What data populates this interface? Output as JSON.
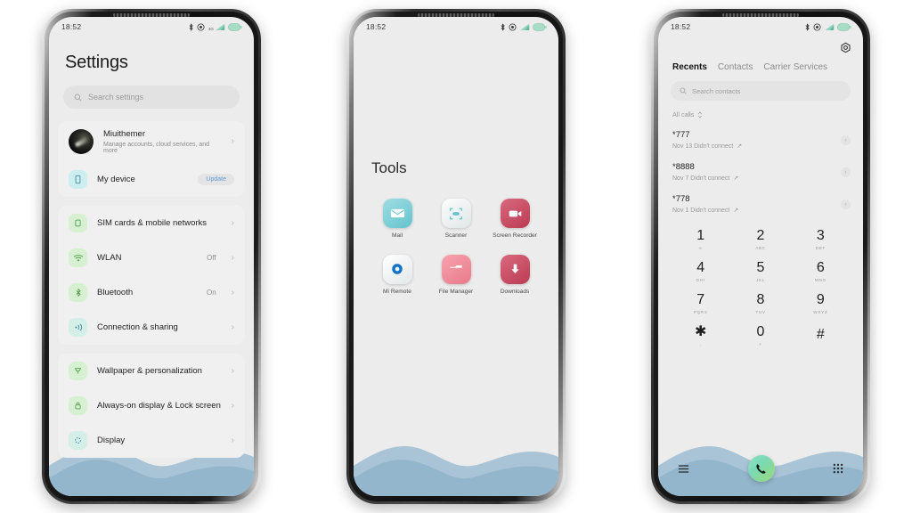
{
  "phones": {
    "settings": {
      "status": {
        "time": "18:52",
        "network": "4G",
        "icons": [
          "bluetooth-icon",
          "mute-icon",
          "signal-icon",
          "battery-icon"
        ]
      },
      "title": "Settings",
      "search_placeholder": "Search settings",
      "account": {
        "name": "Miuithemer",
        "subtitle": "Manage accounts, cloud services, and more",
        "chevron": "›"
      },
      "device": {
        "label": "My device",
        "badge": "Update",
        "badge_color": "#5b9bd5"
      },
      "items": [
        {
          "label": "SIM cards & mobile networks",
          "value": "",
          "icon": "sim-icon",
          "color": "#d8f0d2"
        },
        {
          "label": "WLAN",
          "value": "Off",
          "icon": "wifi-icon",
          "color": "#d8f0d2"
        },
        {
          "label": "Bluetooth",
          "value": "On",
          "icon": "bluetooth-icon",
          "color": "#d8f0d2"
        },
        {
          "label": "Connection & sharing",
          "value": "",
          "icon": "share-icon",
          "color": "#d4eee8"
        }
      ],
      "items2": [
        {
          "label": "Wallpaper & personalization",
          "value": "",
          "icon": "wallpaper-icon",
          "color": "#d8f0d2"
        },
        {
          "label": "Always-on display & Lock screen",
          "value": "",
          "icon": "lock-icon",
          "color": "#d8f0d2"
        },
        {
          "label": "Display",
          "value": "",
          "icon": "display-icon",
          "color": "#d4eee8"
        }
      ],
      "chevron": "›"
    },
    "tools": {
      "status": {
        "time": "18:52",
        "network": "",
        "icons": [
          "bluetooth-icon",
          "mute-icon",
          "signal-icon",
          "battery-icon"
        ]
      },
      "title": "Tools",
      "apps": [
        {
          "name": "Mail",
          "icon": "mail-icon",
          "color": "#7fd0d8"
        },
        {
          "name": "Scanner",
          "icon": "scanner-icon",
          "color": "#eef1f1"
        },
        {
          "name": "Screen Recorder",
          "icon": "recorder-icon",
          "color": "#c94b60"
        },
        {
          "name": "Mi Remote",
          "icon": "remote-icon",
          "color": "#f2f4f5"
        },
        {
          "name": "File Manager",
          "icon": "folder-icon",
          "color": "#ef8a97"
        },
        {
          "name": "Downloads",
          "icon": "download-icon",
          "color": "#c94b60"
        }
      ]
    },
    "dialer": {
      "status": {
        "time": "18:52",
        "network": "",
        "icons": [
          "bluetooth-icon",
          "mute-icon",
          "signal-icon",
          "battery-icon"
        ]
      },
      "gear": "settings-gear-icon",
      "tabs": [
        {
          "label": "Recents",
          "active": true
        },
        {
          "label": "Contacts",
          "active": false
        },
        {
          "label": "Carrier Services",
          "active": false
        }
      ],
      "search_placeholder": "Search contacts",
      "filter": "All calls",
      "calls": [
        {
          "number": "*777",
          "meta": "Nov 13 Didn't connect",
          "arrow": "↗",
          "chevron": "›"
        },
        {
          "number": "*8888",
          "meta": "Nov 7 Didn't connect",
          "arrow": "↗",
          "chevron": "›"
        },
        {
          "number": "*778",
          "meta": "Nov 1 Didn't connect",
          "arrow": "↗",
          "chevron": "›"
        }
      ],
      "keypad": [
        {
          "digit": "1",
          "letters": "∞"
        },
        {
          "digit": "2",
          "letters": "ABC"
        },
        {
          "digit": "3",
          "letters": "DEF"
        },
        {
          "digit": "4",
          "letters": "GHI"
        },
        {
          "digit": "5",
          "letters": "JKL"
        },
        {
          "digit": "6",
          "letters": "MNO"
        },
        {
          "digit": "7",
          "letters": "PQRS"
        },
        {
          "digit": "8",
          "letters": "TUV"
        },
        {
          "digit": "9",
          "letters": "WXYZ"
        },
        {
          "digit": "✱",
          "letters": ","
        },
        {
          "digit": "0",
          "letters": "+"
        },
        {
          "digit": "#",
          "letters": ""
        }
      ],
      "bottom": {
        "menu": "menu-icon",
        "call": "call-icon",
        "keypad": "keypad-icon"
      }
    }
  },
  "theme": {
    "screen_bg": "#ececec",
    "card_bg": "#f0f0f0",
    "wallpaper_back": "#a9c4d6",
    "wallpaper_front": "#8fb4ca"
  }
}
